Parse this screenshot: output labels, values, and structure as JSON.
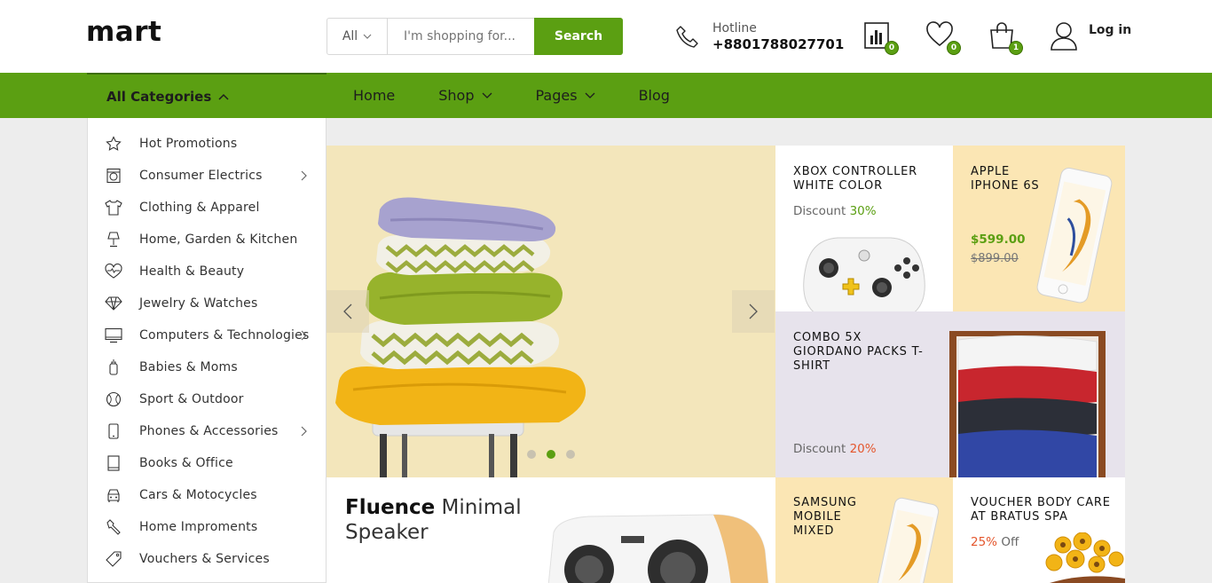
{
  "logo": "mart",
  "search": {
    "category": "All",
    "placeholder": "I'm shopping for...",
    "button": "Search"
  },
  "hotline": {
    "label": "Hotline",
    "number": "+8801788027701"
  },
  "header_icons": {
    "compare_count": "0",
    "wishlist_count": "0",
    "cart_count": "1",
    "login_label": "Log in"
  },
  "nav": {
    "all_categories": "All Categories",
    "links": [
      "Home",
      "Shop",
      "Pages",
      "Blog"
    ]
  },
  "categories": [
    {
      "label": "Hot Promotions",
      "icon": "star-icon",
      "has_sub": false
    },
    {
      "label": "Consumer Electrics",
      "icon": "washing-machine-icon",
      "has_sub": true
    },
    {
      "label": "Clothing & Apparel",
      "icon": "shirt-icon",
      "has_sub": false
    },
    {
      "label": "Home, Garden & Kitchen",
      "icon": "lamp-icon",
      "has_sub": false
    },
    {
      "label": "Health & Beauty",
      "icon": "heart-pulse-icon",
      "has_sub": false
    },
    {
      "label": "Jewelry & Watches",
      "icon": "diamond-icon",
      "has_sub": false
    },
    {
      "label": "Computers & Technologies",
      "icon": "monitor-icon",
      "has_sub": true
    },
    {
      "label": "Babies & Moms",
      "icon": "baby-bottle-icon",
      "has_sub": false
    },
    {
      "label": "Sport & Outdoor",
      "icon": "ball-icon",
      "has_sub": false
    },
    {
      "label": "Phones & Accessories",
      "icon": "phone-icon",
      "has_sub": true
    },
    {
      "label": "Books & Office",
      "icon": "book-icon",
      "has_sub": false
    },
    {
      "label": "Cars & Motocycles",
      "icon": "car-icon",
      "has_sub": false
    },
    {
      "label": "Home Impro​ments",
      "icon": "wrench-icon",
      "has_sub": false
    },
    {
      "label": "Vouchers & Services",
      "icon": "tag-icon",
      "has_sub": false
    }
  ],
  "tiles": {
    "xbox": {
      "title": "XBOX CONTROLLER WHITE COLOR",
      "discount_label": "Discount",
      "discount_value": "30%"
    },
    "iphone": {
      "title": "APPLE IPHONE 6S",
      "price": "$599.00",
      "old_price": "$899.00"
    },
    "combo": {
      "title": "COMBO 5X GIORDANO PACKS T-SHIRT",
      "discount_label": "Discount",
      "discount_value": "20%"
    },
    "samsung": {
      "title": "SAMSUNG MOBILE MIXED"
    },
    "voucher": {
      "title": "VOUCHER BODY CARE AT BRATUS SPA",
      "discount_value": "25%",
      "discount_label": "Off"
    }
  },
  "banner": {
    "title_bold": "Fluence",
    "title_rest": " Minimal Speaker"
  },
  "slider": {
    "dots": 3,
    "active_dot": 1
  },
  "colors": {
    "accent": "#5b9f12",
    "hero_bg": "#f3e6bb",
    "tile_yellow": "#fbe6b4",
    "tile_lavender": "#e7e3ec",
    "sale_red": "#e4572e"
  }
}
